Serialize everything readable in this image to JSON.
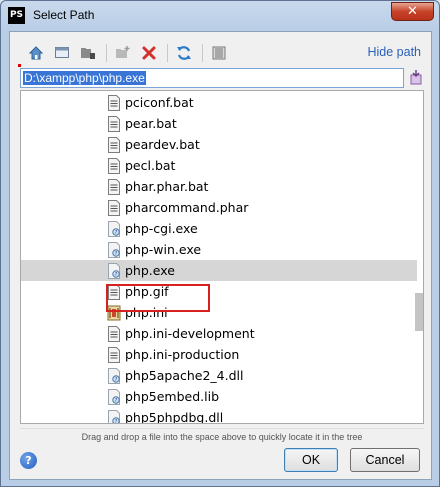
{
  "window": {
    "title": "Select Path",
    "app_icon_text": "PS",
    "close_glyph": "✕"
  },
  "toolbar": {
    "hide_path_label": "Hide path",
    "icons": [
      "home-icon",
      "desktop-icon",
      "project-icon",
      "new-folder-icon",
      "delete-icon",
      "refresh-icon",
      "show-hidden-icon"
    ]
  },
  "path_field": {
    "value": "D:\\xampp\\php\\php.exe"
  },
  "tree": {
    "items": [
      {
        "name": "pciconf.bat",
        "type": "bat"
      },
      {
        "name": "pear.bat",
        "type": "bat"
      },
      {
        "name": "peardev.bat",
        "type": "bat"
      },
      {
        "name": "pecl.bat",
        "type": "bat"
      },
      {
        "name": "phar.phar.bat",
        "type": "bat"
      },
      {
        "name": "pharcommand.phar",
        "type": "bat"
      },
      {
        "name": "php-cgi.exe",
        "type": "exe"
      },
      {
        "name": "php-win.exe",
        "type": "exe"
      },
      {
        "name": "php.exe",
        "type": "exe",
        "selected": true
      },
      {
        "name": "php.gif",
        "type": "bat"
      },
      {
        "name": "php.ini",
        "type": "ini"
      },
      {
        "name": "php.ini-development",
        "type": "bat"
      },
      {
        "name": "php.ini-production",
        "type": "bat"
      },
      {
        "name": "php5apache2_4.dll",
        "type": "exe"
      },
      {
        "name": "php5embed.lib",
        "type": "exe"
      },
      {
        "name": "php5phpdbg.dll",
        "type": "exe"
      }
    ]
  },
  "hint": "Drag and drop a file into the space above to quickly locate it in the tree",
  "buttons": {
    "help": "?",
    "ok": "OK",
    "cancel": "Cancel"
  },
  "colors": {
    "selection_highlight": "#3875d7",
    "link": "#2b61b8",
    "annotation_box": "#d62121"
  }
}
